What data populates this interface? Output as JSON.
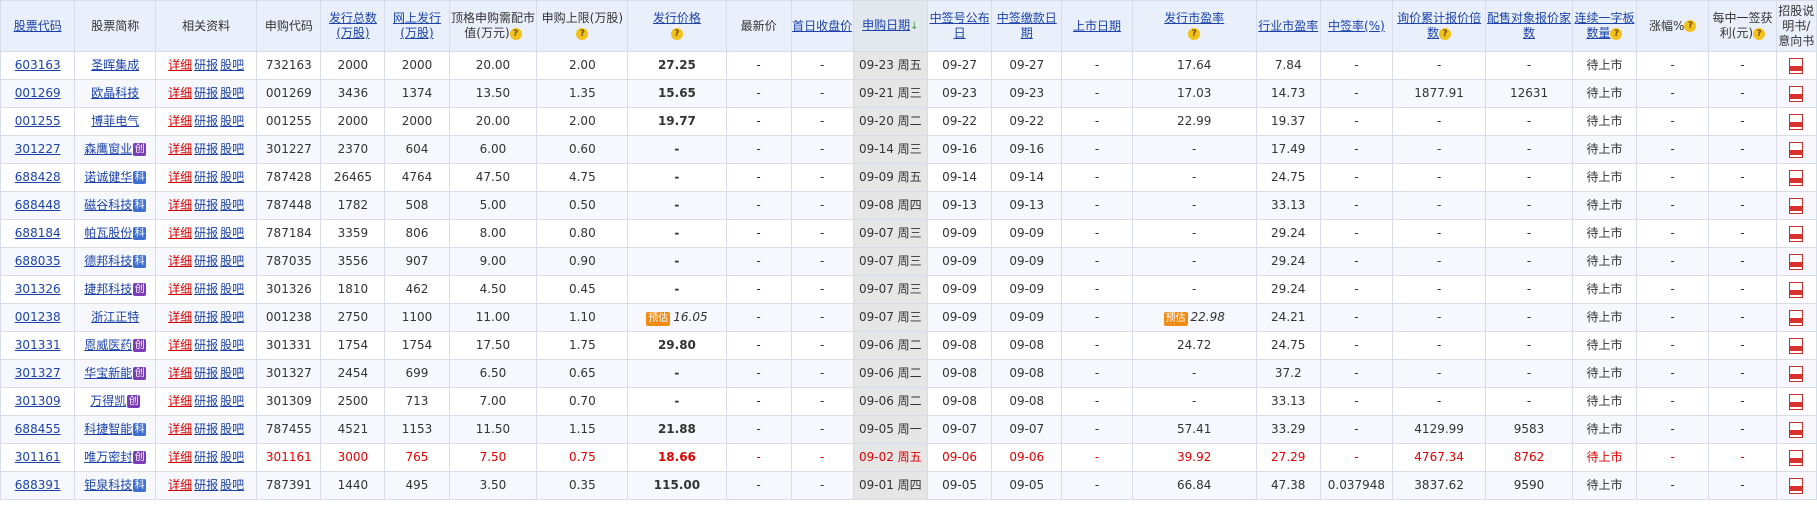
{
  "headers": {
    "code": "股票代码",
    "name": "股票简称",
    "related": "相关资料",
    "sub_code": "申购代码",
    "total_issue": "发行总数(万股)",
    "online_issue": "网上发行(万股)",
    "top_market_value": "顶格申购需配市值(万元)",
    "sub_limit": "申购上限(万股)",
    "price": "发行价格",
    "latest_price": "最新价",
    "first_day_close": "首日收盘价",
    "sub_date": "申购日期",
    "lottery_date": "中签号公布日",
    "pay_date": "中签缴款日期",
    "listing_date": "上市日期",
    "issue_pe": "发行市盈率",
    "industry_pe": "行业市盈率",
    "win_rate": "中签率(%)",
    "inquiry_multiple": "询价累计报价倍数",
    "placement_count": "配售对象报价家数",
    "consecutive_boards": "连续一字板数量",
    "rise": "涨幅%",
    "profit_per_win": "每中一签获利(元)",
    "prospectus": "招股说明书/意向书"
  },
  "labels": {
    "detail": "详细",
    "research": "研报",
    "forum": "股吧",
    "estimate": "预估",
    "chuang_tag": "创",
    "ke_tag": "科",
    "question": "?",
    "sort_arrow": "↓"
  },
  "rows": [
    {
      "code": "603163",
      "name": "圣晖集成",
      "sub_code": "732163",
      "total": "2000",
      "online": "2000",
      "top": "20.00",
      "limit": "2.00",
      "price": "27.25",
      "latest": "-",
      "first": "-",
      "date": "09-23 周五",
      "lottery": "09-27",
      "pay": "09-27",
      "listing": "-",
      "issue_pe": "17.64",
      "industry_pe": "7.84",
      "win_rate": "-",
      "inquiry": "-",
      "placement": "-",
      "boards": "待上市",
      "rise": "-",
      "profit": "-"
    },
    {
      "code": "001269",
      "name": "欧晶科技",
      "sub_code": "001269",
      "total": "3436",
      "online": "1374",
      "top": "13.50",
      "limit": "1.35",
      "price": "15.65",
      "latest": "-",
      "first": "-",
      "date": "09-21 周三",
      "lottery": "09-23",
      "pay": "09-23",
      "listing": "-",
      "issue_pe": "17.03",
      "industry_pe": "14.73",
      "win_rate": "-",
      "inquiry": "1877.91",
      "placement": "12631",
      "boards": "待上市",
      "rise": "-",
      "profit": "-"
    },
    {
      "code": "001255",
      "name": "博菲电气",
      "sub_code": "001255",
      "total": "2000",
      "online": "2000",
      "top": "20.00",
      "limit": "2.00",
      "price": "19.77",
      "latest": "-",
      "first": "-",
      "date": "09-20 周二",
      "lottery": "09-22",
      "pay": "09-22",
      "listing": "-",
      "issue_pe": "22.99",
      "industry_pe": "19.37",
      "win_rate": "-",
      "inquiry": "-",
      "placement": "-",
      "boards": "待上市",
      "rise": "-",
      "profit": "-"
    },
    {
      "code": "301227",
      "name": "森鹰窗业",
      "tag": "创",
      "sub_code": "301227",
      "total": "2370",
      "online": "604",
      "top": "6.00",
      "limit": "0.60",
      "price": "-",
      "latest": "-",
      "first": "-",
      "date": "09-14 周三",
      "lottery": "09-16",
      "pay": "09-16",
      "listing": "-",
      "issue_pe": "-",
      "industry_pe": "17.49",
      "win_rate": "-",
      "inquiry": "-",
      "placement": "-",
      "boards": "待上市",
      "rise": "-",
      "profit": "-"
    },
    {
      "code": "688428",
      "name": "诺诚健华",
      "tag": "科",
      "sub_code": "787428",
      "total": "26465",
      "online": "4764",
      "top": "47.50",
      "limit": "4.75",
      "price": "-",
      "latest": "-",
      "first": "-",
      "date": "09-09 周五",
      "lottery": "09-14",
      "pay": "09-14",
      "listing": "-",
      "issue_pe": "-",
      "industry_pe": "24.75",
      "win_rate": "-",
      "inquiry": "-",
      "placement": "-",
      "boards": "待上市",
      "rise": "-",
      "profit": "-"
    },
    {
      "code": "688448",
      "name": "磁谷科技",
      "tag": "科",
      "sub_code": "787448",
      "total": "1782",
      "online": "508",
      "top": "5.00",
      "limit": "0.50",
      "price": "-",
      "latest": "-",
      "first": "-",
      "date": "09-08 周四",
      "lottery": "09-13",
      "pay": "09-13",
      "listing": "-",
      "issue_pe": "-",
      "industry_pe": "33.13",
      "win_rate": "-",
      "inquiry": "-",
      "placement": "-",
      "boards": "待上市",
      "rise": "-",
      "profit": "-"
    },
    {
      "code": "688184",
      "name": "帕瓦股份",
      "tag": "科",
      "sub_code": "787184",
      "total": "3359",
      "online": "806",
      "top": "8.00",
      "limit": "0.80",
      "price": "-",
      "latest": "-",
      "first": "-",
      "date": "09-07 周三",
      "lottery": "09-09",
      "pay": "09-09",
      "listing": "-",
      "issue_pe": "-",
      "industry_pe": "29.24",
      "win_rate": "-",
      "inquiry": "-",
      "placement": "-",
      "boards": "待上市",
      "rise": "-",
      "profit": "-"
    },
    {
      "code": "688035",
      "name": "德邦科技",
      "tag": "科",
      "sub_code": "787035",
      "total": "3556",
      "online": "907",
      "top": "9.00",
      "limit": "0.90",
      "price": "-",
      "latest": "-",
      "first": "-",
      "date": "09-07 周三",
      "lottery": "09-09",
      "pay": "09-09",
      "listing": "-",
      "issue_pe": "-",
      "industry_pe": "29.24",
      "win_rate": "-",
      "inquiry": "-",
      "placement": "-",
      "boards": "待上市",
      "rise": "-",
      "profit": "-"
    },
    {
      "code": "301326",
      "name": "捷邦科技",
      "tag": "创",
      "sub_code": "301326",
      "total": "1810",
      "online": "462",
      "top": "4.50",
      "limit": "0.45",
      "price": "-",
      "latest": "-",
      "first": "-",
      "date": "09-07 周三",
      "lottery": "09-09",
      "pay": "09-09",
      "listing": "-",
      "issue_pe": "-",
      "industry_pe": "29.24",
      "win_rate": "-",
      "inquiry": "-",
      "placement": "-",
      "boards": "待上市",
      "rise": "-",
      "profit": "-"
    },
    {
      "code": "001238",
      "name": "浙江正特",
      "sub_code": "001238",
      "total": "2750",
      "online": "1100",
      "top": "11.00",
      "limit": "1.10",
      "price": "16.05",
      "price_est": true,
      "latest": "-",
      "first": "-",
      "date": "09-07 周三",
      "lottery": "09-09",
      "pay": "09-09",
      "listing": "-",
      "issue_pe": "22.98",
      "pe_est": true,
      "industry_pe": "24.21",
      "win_rate": "-",
      "inquiry": "-",
      "placement": "-",
      "boards": "待上市",
      "rise": "-",
      "profit": "-"
    },
    {
      "code": "301331",
      "name": "恩威医药",
      "tag": "创",
      "sub_code": "301331",
      "total": "1754",
      "online": "1754",
      "top": "17.50",
      "limit": "1.75",
      "price": "29.80",
      "latest": "-",
      "first": "-",
      "date": "09-06 周二",
      "lottery": "09-08",
      "pay": "09-08",
      "listing": "-",
      "issue_pe": "24.72",
      "industry_pe": "24.75",
      "win_rate": "-",
      "inquiry": "-",
      "placement": "-",
      "boards": "待上市",
      "rise": "-",
      "profit": "-"
    },
    {
      "code": "301327",
      "name": "华宝新能",
      "tag": "创",
      "sub_code": "301327",
      "total": "2454",
      "online": "699",
      "top": "6.50",
      "limit": "0.65",
      "price": "-",
      "latest": "-",
      "first": "-",
      "date": "09-06 周二",
      "lottery": "09-08",
      "pay": "09-08",
      "listing": "-",
      "issue_pe": "-",
      "industry_pe": "37.2",
      "win_rate": "-",
      "inquiry": "-",
      "placement": "-",
      "boards": "待上市",
      "rise": "-",
      "profit": "-"
    },
    {
      "code": "301309",
      "name": "万得凯",
      "tag": "创",
      "sub_code": "301309",
      "total": "2500",
      "online": "713",
      "top": "7.00",
      "limit": "0.70",
      "price": "-",
      "latest": "-",
      "first": "-",
      "date": "09-06 周二",
      "lottery": "09-08",
      "pay": "09-08",
      "listing": "-",
      "issue_pe": "-",
      "industry_pe": "33.13",
      "win_rate": "-",
      "inquiry": "-",
      "placement": "-",
      "boards": "待上市",
      "rise": "-",
      "profit": "-"
    },
    {
      "code": "688455",
      "name": "科捷智能",
      "tag": "科",
      "sub_code": "787455",
      "total": "4521",
      "online": "1153",
      "top": "11.50",
      "limit": "1.15",
      "price": "21.88",
      "latest": "-",
      "first": "-",
      "date": "09-05 周一",
      "lottery": "09-07",
      "pay": "09-07",
      "listing": "-",
      "issue_pe": "57.41",
      "industry_pe": "33.29",
      "win_rate": "-",
      "inquiry": "4129.99",
      "placement": "9583",
      "boards": "待上市",
      "rise": "-",
      "profit": "-"
    },
    {
      "code": "301161",
      "name": "唯万密封",
      "tag": "创",
      "red": true,
      "sub_code": "301161",
      "total": "3000",
      "online": "765",
      "top": "7.50",
      "limit": "0.75",
      "price": "18.66",
      "latest": "-",
      "first": "-",
      "date": "09-02 周五",
      "lottery": "09-06",
      "pay": "09-06",
      "listing": "-",
      "issue_pe": "39.92",
      "industry_pe": "27.29",
      "win_rate": "-",
      "inquiry": "4767.34",
      "placement": "8762",
      "boards": "待上市",
      "rise": "-",
      "profit": "-"
    },
    {
      "code": "688391",
      "name": "钜泉科技",
      "tag": "科",
      "sub_code": "787391",
      "total": "1440",
      "online": "495",
      "top": "3.50",
      "limit": "0.35",
      "price": "115.00",
      "latest": "-",
      "first": "-",
      "date": "09-01 周四",
      "lottery": "09-05",
      "pay": "09-05",
      "listing": "-",
      "issue_pe": "66.84",
      "industry_pe": "47.38",
      "win_rate": "0.037948",
      "inquiry": "3837.62",
      "placement": "9590",
      "boards": "待上市",
      "rise": "-",
      "profit": "-"
    }
  ]
}
